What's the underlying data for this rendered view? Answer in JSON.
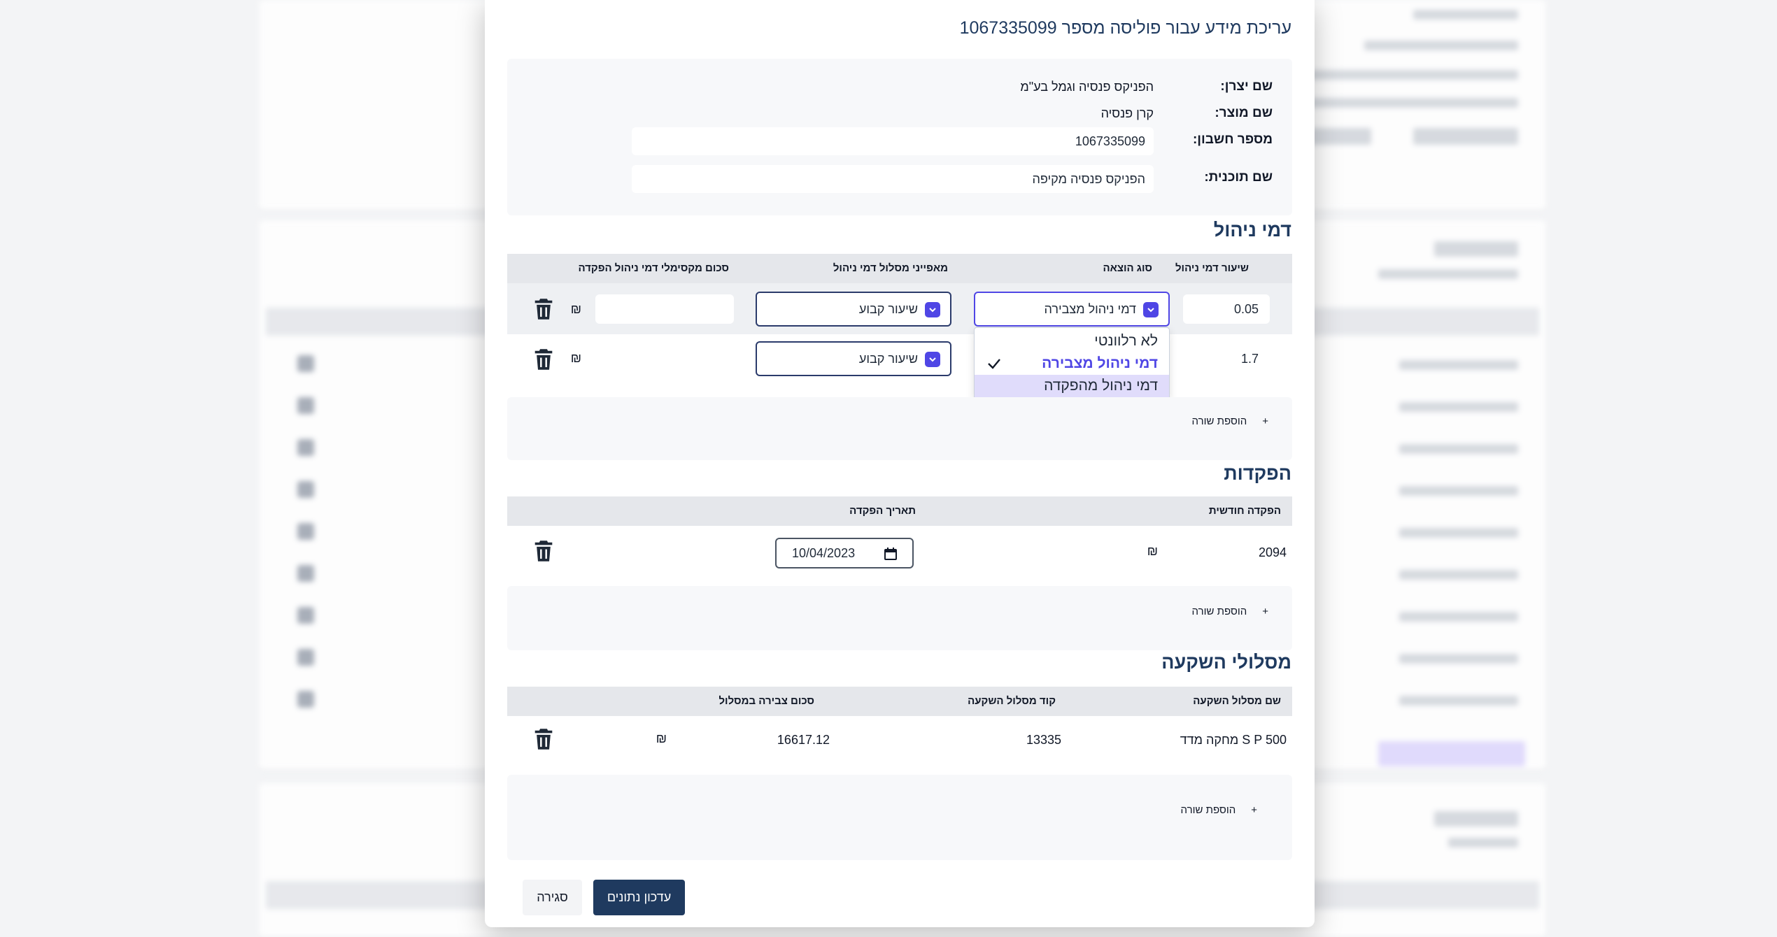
{
  "modal": {
    "title": "עריכת מידע עבור פוליסה מספר 1067335099",
    "info": {
      "manufacturer_label": "שם יצרן:",
      "manufacturer_value": "הפניקס פנסיה וגמל בע\"מ",
      "product_label": "שם מוצר:",
      "product_value": "קרן פנסיה",
      "account_label": "מספר חשבון:",
      "account_value": "1067335099",
      "plan_label": "שם תוכנית:",
      "plan_value": "הפניקס פנסיה מקיפה"
    },
    "fees": {
      "title": "דמי ניהול",
      "headers": {
        "rate": "שיעור דמי ניהול",
        "type": "סוג הוצאה",
        "track": "מאפייני מסלול דמי ניהול",
        "max": "סכום מקסימלי דמי ניהול הפקדה"
      },
      "rows": [
        {
          "rate": "0.05",
          "type": "דמי ניהול מצבירה",
          "track": "שיעור קבוע",
          "max": "",
          "currency": "₪"
        },
        {
          "rate": "1.7",
          "type": "",
          "track": "שיעור קבוע",
          "max": "",
          "currency": "₪"
        }
      ],
      "dropdown_options": [
        {
          "label": "לא רלוונטי",
          "state": "normal"
        },
        {
          "label": "דמי ניהול מצבירה",
          "state": "selected"
        },
        {
          "label": "דמי ניהול מהפקדה",
          "state": "hover"
        }
      ],
      "add_label": "הוספת שורה",
      "add_symbol": "+"
    },
    "deposits": {
      "title": "הפקדות",
      "headers": {
        "monthly": "הפקדה חודשית",
        "date": "תאריך הפקדה"
      },
      "rows": [
        {
          "monthly": "2094",
          "currency": "₪",
          "date": "10/04/2023"
        }
      ],
      "add_label": "הוספת שורה",
      "add_symbol": "+"
    },
    "tracks": {
      "title": "מסלולי השקעה",
      "headers": {
        "name": "שם מסלול השקעה",
        "code": "קוד מסלול השקעה",
        "amount": "סכום צבירה במסלול"
      },
      "rows": [
        {
          "name": "S P 500 מחקה מדד",
          "code": "13335",
          "amount": "16617.12",
          "currency": "₪"
        }
      ],
      "add_label": "הוספת שורה",
      "add_symbol": "+"
    },
    "buttons": {
      "update": "עדכון נתונים",
      "close": "סגירה"
    }
  },
  "colors": {
    "primary": "#1f3a5f",
    "accent": "#4f46e5",
    "header_bg": "#e5e7eb",
    "panel_bg": "#f7f8fa"
  }
}
